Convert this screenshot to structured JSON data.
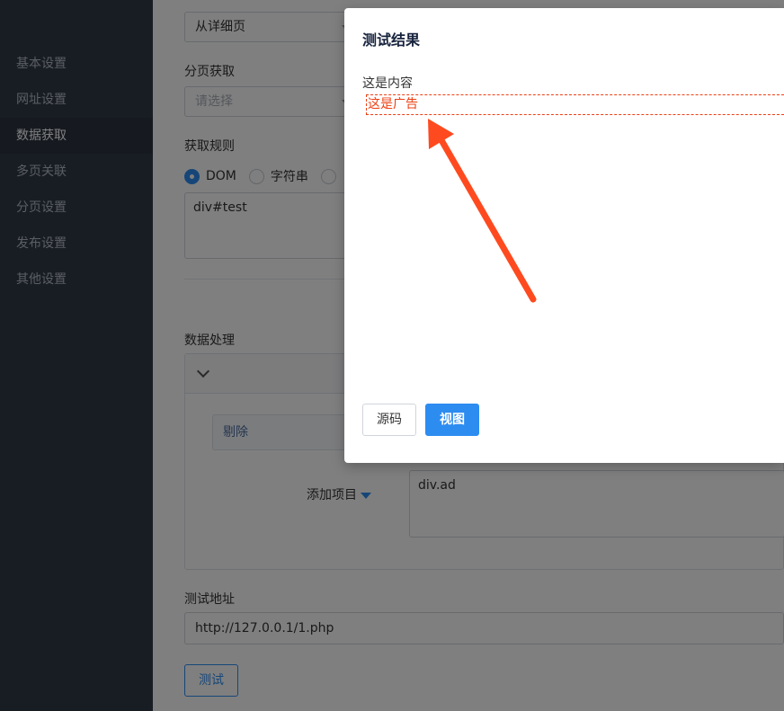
{
  "sidebar": {
    "items": [
      {
        "label": "基本设置"
      },
      {
        "label": "网址设置"
      },
      {
        "label": "数据获取"
      },
      {
        "label": "多页关联"
      },
      {
        "label": "分页设置"
      },
      {
        "label": "发布设置"
      },
      {
        "label": "其他设置"
      }
    ],
    "active_index": 2
  },
  "form": {
    "source_select_value": "从详细页",
    "paging_label": "分页获取",
    "paging_placeholder": "请选择",
    "rule_label": "获取规则",
    "rule_options": [
      "DOM",
      "字符串"
    ],
    "rule_selected": "DOM",
    "rule_value": "div#test",
    "processing_label": "数据处理",
    "remove_chip": "剔除",
    "add_item_label": "添加项目",
    "remove_value": "div.ad",
    "test_url_label": "测试地址",
    "test_url_value": "http://127.0.0.1/1.php",
    "test_button": "测试"
  },
  "modal": {
    "title": "测试结果",
    "content_text": "这是内容",
    "ad_text": "这是广告",
    "source_button": "源码",
    "view_button": "视图"
  },
  "colors": {
    "sidebar_bg": "#313a48",
    "primary": "#2d8cf0",
    "ad_highlight": "#ed4014",
    "annotation_arrow": "#ff4a1f"
  }
}
